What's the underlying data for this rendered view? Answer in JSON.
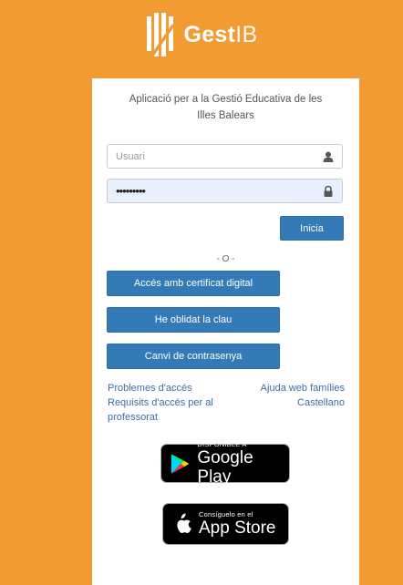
{
  "header": {
    "brand_bold": "Gest",
    "brand_thin": "IB"
  },
  "card": {
    "subtitle": "Aplicació per a la Gestió Educativa de les Illes Balears",
    "username": {
      "placeholder": "Usuari",
      "value": ""
    },
    "password": {
      "value": "•••••••••"
    },
    "login_label": "Inicia",
    "separator": "- O -",
    "cert_label": "Accés amb certificat digital",
    "forgot_label": "He oblidat la clau",
    "change_pwd_label": "Canvi de contrasenya",
    "links_left": [
      "Problemes d'accés",
      "Requisits d'accés per al professorat"
    ],
    "links_right": [
      "Ajuda web famílies",
      "Castellano"
    ]
  },
  "stores": {
    "google": {
      "small": "DISPONIBLE A",
      "big": "Google Play"
    },
    "apple": {
      "small": "Consíguelo en el",
      "big": "App Store"
    }
  },
  "colors": {
    "background": "#f19c32",
    "button": "#337ab7",
    "link": "#3a6ea5"
  }
}
